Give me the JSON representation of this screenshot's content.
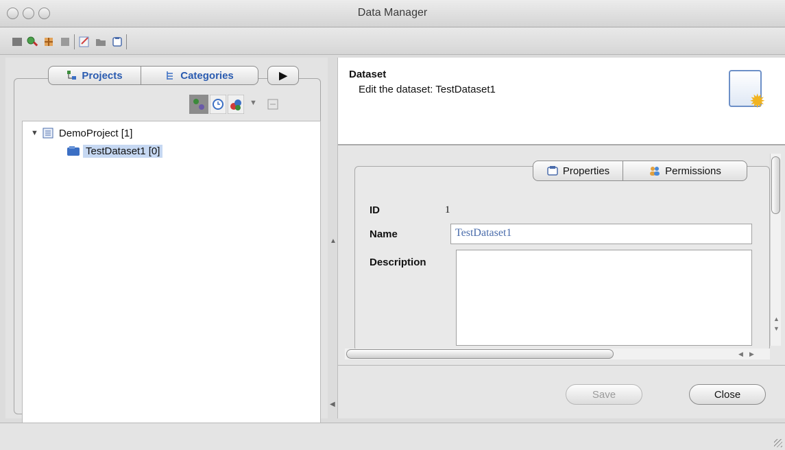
{
  "window": {
    "title": "Data Manager"
  },
  "left": {
    "tabs": [
      {
        "label": "Projects"
      },
      {
        "label": "Categories"
      }
    ],
    "more_arrow": "▶",
    "tree": [
      {
        "label": "DemoProject [1]",
        "expanded": true
      },
      {
        "label": "TestDataset1 [0]",
        "selected": true
      }
    ]
  },
  "right": {
    "header": {
      "title": "Dataset",
      "subtitle": "Edit the dataset: TestDataset1"
    },
    "tabs": [
      {
        "label": "Properties"
      },
      {
        "label": "Permissions"
      }
    ],
    "form": {
      "id_label": "ID",
      "id_value": "1",
      "name_label": "Name",
      "name_value": "TestDataset1",
      "description_label": "Description",
      "description_value": ""
    },
    "buttons": {
      "save": "Save",
      "close": "Close"
    }
  },
  "colors": {
    "accent": "#2a5bb0",
    "selection": "#c6d8f2"
  }
}
